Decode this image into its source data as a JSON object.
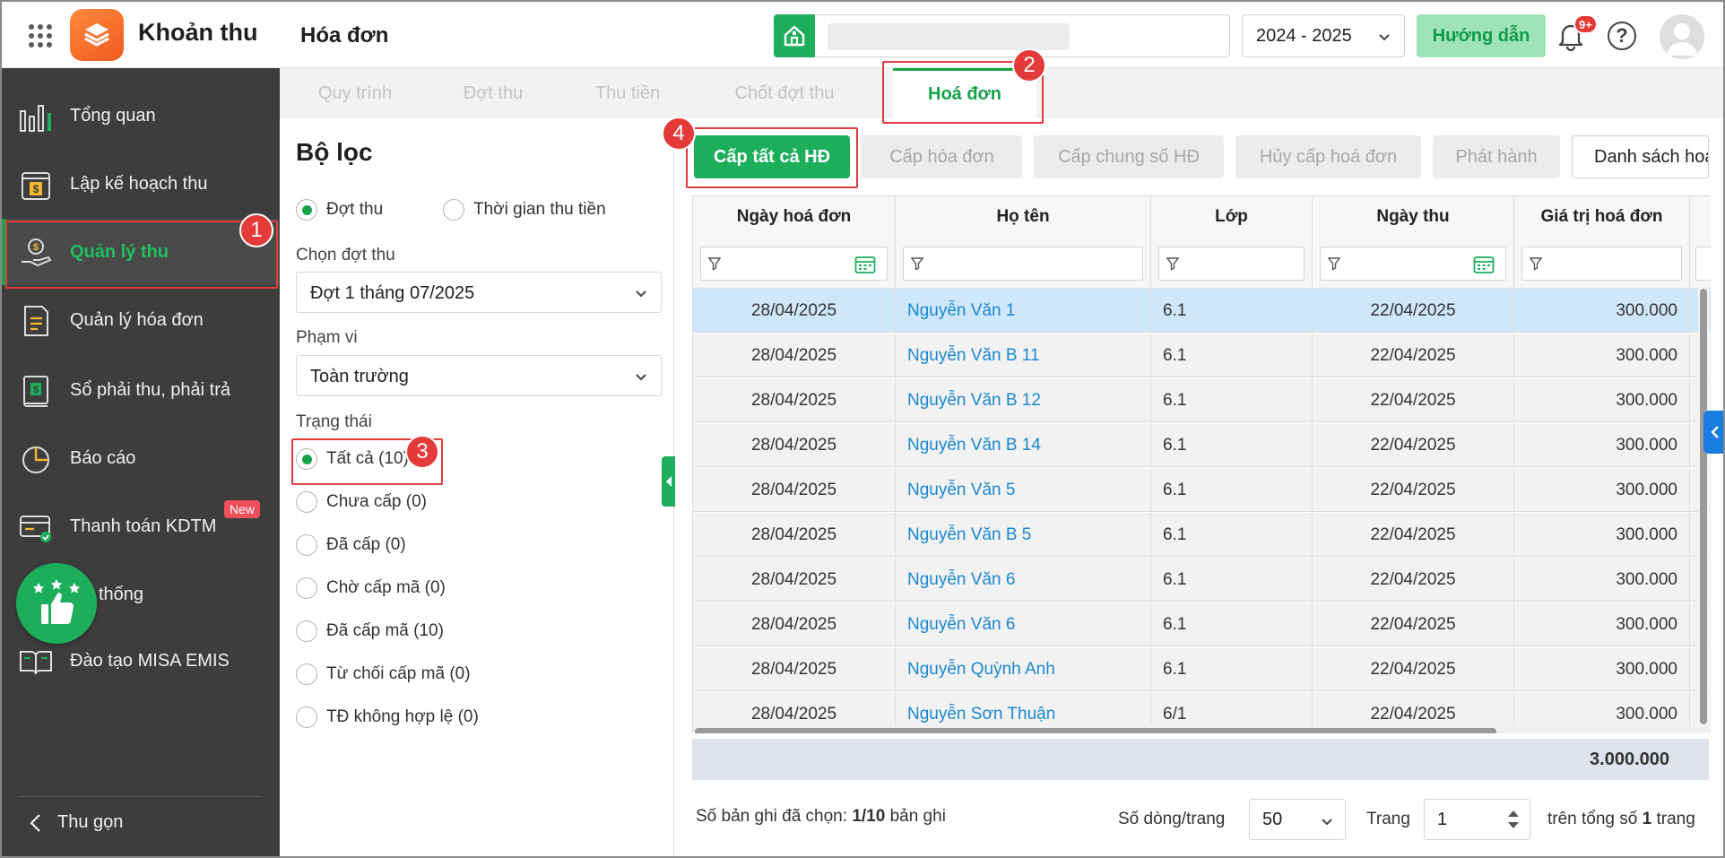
{
  "header": {
    "app_name": "Khoản thu",
    "page_title": "Hóa đơn",
    "school_year": "2024 - 2025",
    "guide_label": "Hướng dẫn",
    "notification_count": "9+",
    "help_glyph": "?"
  },
  "sidebar": {
    "items": [
      {
        "label": "Tổng quan",
        "icon": "bar-chart-icon"
      },
      {
        "label": "Lập kế hoạch thu",
        "icon": "calendar-dollar-icon"
      },
      {
        "label": "Quản lý thu",
        "icon": "hand-money-icon"
      },
      {
        "label": "Quản lý hóa đơn",
        "icon": "invoice-icon"
      },
      {
        "label": "Sổ phải thu, phải trả",
        "icon": "ledger-icon"
      },
      {
        "label": "Báo cáo",
        "icon": "pie-chart-icon"
      },
      {
        "label": "Thanh toán KDTM",
        "icon": "card-check-icon"
      },
      {
        "label": "thống",
        "icon": "settings-icon"
      },
      {
        "label": "Đào tạo MISA EMIS",
        "icon": "open-book-icon"
      }
    ],
    "active_index": 2,
    "new_badge": "New",
    "collapse_label": "Thu gọn"
  },
  "tabs": [
    {
      "label": "Quy trình"
    },
    {
      "label": "Đợt thu"
    },
    {
      "label": "Thu tiền"
    },
    {
      "label": "Chốt đợt thu"
    },
    {
      "label": "Hoá đơn"
    }
  ],
  "filter": {
    "title": "Bộ lọc",
    "mode_options": [
      "Đợt thu",
      "Thời gian thu tiền"
    ],
    "period_label": "Chọn đợt thu",
    "period_value": "Đợt 1 tháng 07/2025",
    "scope_label": "Phạm vi",
    "scope_value": "Toàn trường",
    "status_label": "Trạng thái",
    "status_options": [
      "Tất cả (10)",
      "Chưa cấp (0)",
      "Đã cấp (0)",
      "Chờ cấp mã (0)",
      "Đã cấp mã (10)",
      "Từ chối cấp mã (0)",
      "TĐ không hợp lệ (0)"
    ]
  },
  "toolbar": {
    "issue_all": "Cấp tất cả HĐ",
    "issue": "Cấp hóa đơn",
    "issue_shared": "Cấp chung số HĐ",
    "cancel_issue": "Hủy cấp hoá đơn",
    "publish": "Phát hành",
    "list": "Danh sách hoá đơn"
  },
  "table": {
    "columns": [
      "Ngày hoá đơn",
      "Họ tên",
      "Lớp",
      "Ngày thu",
      "Giá trị hoá đơn"
    ],
    "rows": [
      [
        "28/04/2025",
        "Nguyễn Văn 1",
        "6.1",
        "22/04/2025",
        "300.000"
      ],
      [
        "28/04/2025",
        "Nguyễn Văn B 11",
        "6.1",
        "22/04/2025",
        "300.000"
      ],
      [
        "28/04/2025",
        "Nguyễn Văn B 12",
        "6.1",
        "22/04/2025",
        "300.000"
      ],
      [
        "28/04/2025",
        "Nguyễn Văn B 14",
        "6.1",
        "22/04/2025",
        "300.000"
      ],
      [
        "28/04/2025",
        "Nguyễn Văn 5",
        "6.1",
        "22/04/2025",
        "300.000"
      ],
      [
        "28/04/2025",
        "Nguyễn Văn B 5",
        "6.1",
        "22/04/2025",
        "300.000"
      ],
      [
        "28/04/2025",
        "Nguyễn Văn 6",
        "6.1",
        "22/04/2025",
        "300.000"
      ],
      [
        "28/04/2025",
        "Nguyễn Văn 6",
        "6.1",
        "22/04/2025",
        "300.000"
      ],
      [
        "28/04/2025",
        "Nguyễn Quỳnh Anh",
        "6.1",
        "22/04/2025",
        "300.000"
      ],
      [
        "28/04/2025",
        "Nguyễn Sơn Thuận",
        "6/1",
        "22/04/2025",
        "300.000"
      ]
    ],
    "selected_row": 0,
    "total": "3.000.000"
  },
  "footer": {
    "selected_prefix": "Số bản ghi đã chọn:",
    "selected_value": "1/10",
    "selected_suffix": "bản ghi",
    "rows_per_page_label": "Số dòng/trang",
    "rows_per_page": "50",
    "page_label": "Trang",
    "page": "1",
    "total_pages_prefix": "trên tổng số",
    "total_pages": "1",
    "total_pages_suffix": "trang"
  },
  "annotations": [
    "1",
    "2",
    "3",
    "4"
  ],
  "colors": {
    "brand_green": "#1dae5b",
    "sidebar_bg": "#3d3d3d",
    "link_blue": "#1a88d1",
    "highlight_red": "#e03a3a",
    "selected_row": "#cfe7fb"
  }
}
